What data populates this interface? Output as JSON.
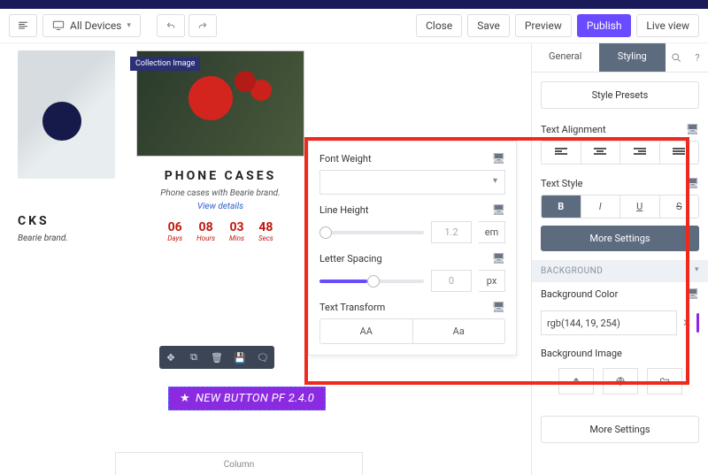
{
  "toolbar": {
    "devices_label": "All Devices",
    "close": "Close",
    "save": "Save",
    "preview": "Preview",
    "publish": "Publish",
    "live_view": "Live view"
  },
  "canvas": {
    "collection_badge": "Collection Image",
    "product_title": "PHONE CASES",
    "product_desc": "Phone cases with Bearie brand.",
    "product_link": "View details",
    "countdown": [
      {
        "num": "06",
        "label": "Days"
      },
      {
        "num": "08",
        "label": "Hours"
      },
      {
        "num": "03",
        "label": "Mins"
      },
      {
        "num": "48",
        "label": "Secs"
      }
    ],
    "cks_title": "CKS",
    "cks_desc": "Bearie brand.",
    "new_button": "NEW BUTTON PF 2.4.0",
    "column_label": "Column"
  },
  "float_panel": {
    "font_weight": "Font Weight",
    "line_height": "Line Height",
    "line_height_val": "1.2",
    "line_height_unit": "em",
    "letter_spacing": "Letter Spacing",
    "letter_spacing_val": "0",
    "letter_spacing_unit": "px",
    "text_transform": "Text Transform",
    "tt_upper": "AA",
    "tt_cap": "Aa"
  },
  "panel": {
    "tab_general": "General",
    "tab_styling": "Styling",
    "presets": "Style Presets",
    "text_alignment": "Text Alignment",
    "text_style": "Text Style",
    "style_b": "B",
    "style_i": "I",
    "style_u": "U",
    "style_s": "S",
    "more_settings": "More Settings",
    "background_group": "BACKGROUND",
    "background_color_label": "Background Color",
    "background_color_value": "rgb(144, 19, 254)",
    "background_image_label": "Background Image",
    "more_settings2": "More Settings"
  }
}
